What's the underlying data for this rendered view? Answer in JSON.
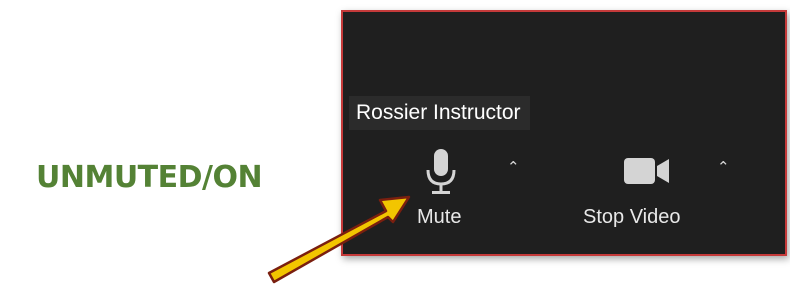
{
  "status": {
    "text": "UNMUTED/ON",
    "color": "#548235"
  },
  "participant": {
    "name": "Rossier Instructor"
  },
  "toolbar": {
    "mute_label": "Mute",
    "video_label": "Stop Video",
    "mute_icon": "microphone-icon",
    "video_icon": "video-camera-icon",
    "caret_icon": "caret-up-icon"
  },
  "colors": {
    "panel_bg": "#1f1f1f",
    "panel_border": "#c53a3a",
    "icon_fill": "#d4d4d4",
    "arrow_fill": "#f2c500",
    "arrow_outline": "#7a1f0f"
  }
}
